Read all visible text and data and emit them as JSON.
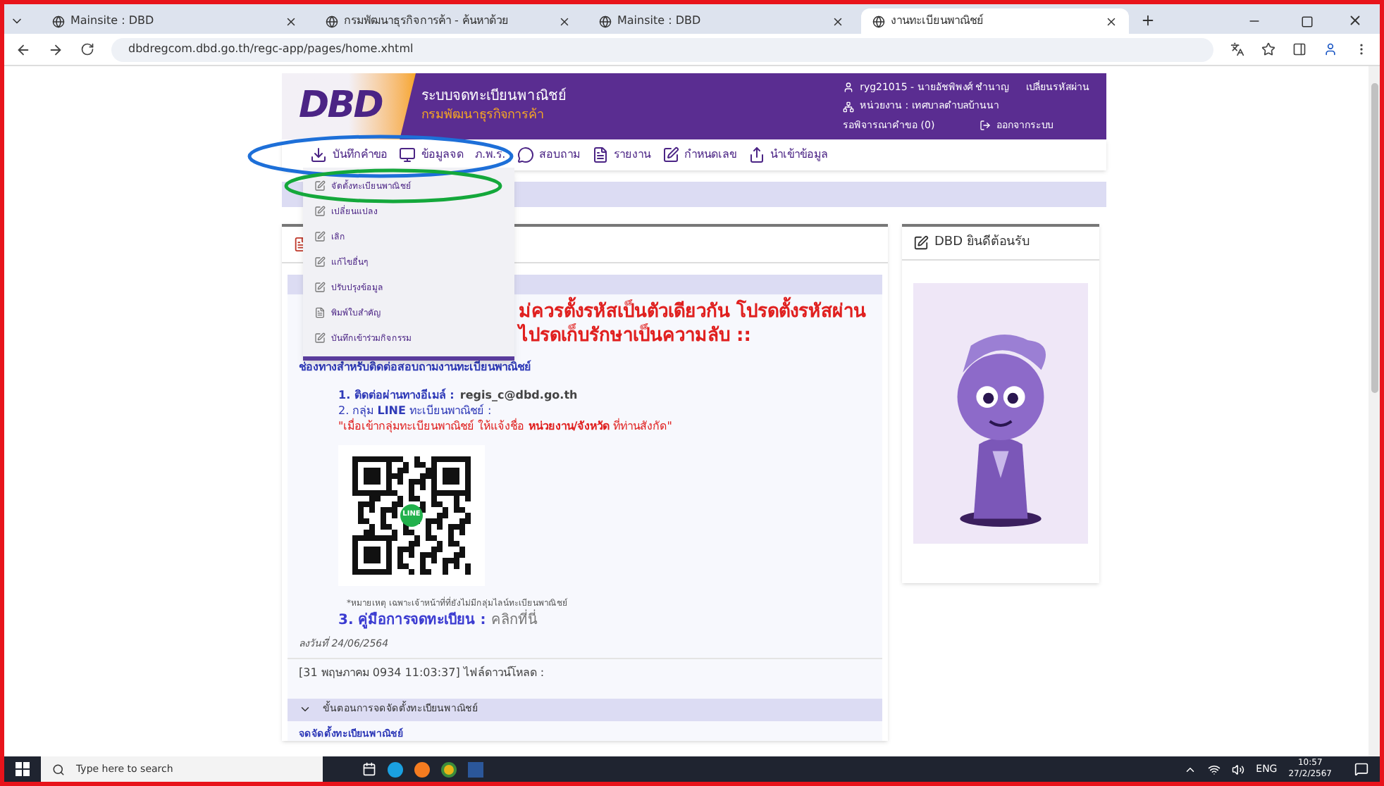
{
  "browser": {
    "tabs": [
      {
        "title": "Mainsite : DBD",
        "selected": false
      },
      {
        "title": "กรมพัฒนาธุรกิจการค้า - ค้นหาด้วย",
        "selected": false
      },
      {
        "title": "Mainsite : DBD",
        "selected": false
      },
      {
        "title": "งานทะเบียนพาณิชย์",
        "selected": true
      }
    ],
    "address": "dbdregcom.dbd.go.th/regc-app/pages/home.xhtml"
  },
  "header": {
    "logo": "DBD",
    "system_name": "ระบบจดทะเบียนพาณิชย์",
    "department": "กรมพัฒนาธุรกิจการค้า",
    "user": "ryg21015 - นายอัชพิพงศ์ ชำนาญ",
    "change_password": "เปลี่ยนรหัสผ่าน",
    "unit": "หน่วยงาน : เทศบาลตำบลบ้านนา",
    "pending": "รอพิจารณาคำขอ (0)",
    "logout": "ออกจากระบบ"
  },
  "nav": [
    {
      "label": "บันทึกคำขอ",
      "kind": "download"
    },
    {
      "label": "ข้อมูลจด",
      "kind": "monitor"
    },
    {
      "label": "ภ.พ.ร.",
      "kind": "none"
    },
    {
      "label": "สอบถาม",
      "kind": "chat"
    },
    {
      "label": "รายงาน",
      "kind": "doc"
    },
    {
      "label": "กำหนดเลข",
      "kind": "edit"
    },
    {
      "label": "นำเข้าข้อมูล",
      "kind": "share"
    }
  ],
  "dropdown": [
    {
      "label": "จัดตั้งทะเบียนพาณิชย์",
      "kind": "edit"
    },
    {
      "label": "เปลี่ยนแปลง",
      "kind": "edit"
    },
    {
      "label": "เลิก",
      "kind": "edit"
    },
    {
      "label": "แก้ไขอื่นๆ",
      "kind": "edit"
    },
    {
      "label": "ปรับปรุงข้อมูล",
      "kind": "edit"
    },
    {
      "label": "พิมพ์ใบสำคัญ",
      "kind": "doc"
    },
    {
      "label": "บันทึกเข้าร่วมกิจกรรม",
      "kind": "edit"
    }
  ],
  "notice": {
    "warning_lines": [
      "ม่ควรตั้งรหัสเป็นตัวเดียวกัน โปรดตั้งรหัสผ่าน",
      "ไปรดเก็บรักษาเป็นความลับ ::"
    ],
    "contact_title": "ช่องทางสำหรับติดต่อสอบถามงานทะเบียนพาณิชย์",
    "email_label": "1. ติดต่อผ่านทางอีเมล์ :",
    "email": "regis_c@dbd.go.th",
    "line_label": "2. กลุ่ม **LINE** ทะเบียนพาณิชย์ :",
    "line_note": "\"เมื่อเข้ากลุ่มทะเบียนพาณิชย์ ให้แจ้งชื่อ **หน่วยงาน/จังหวัด** ที่ท่านสังกัด\"",
    "qr_badge": "LINE",
    "remark": "*หมายเหตุ เฉพาะเจ้าหน้าที่ที่ยังไม่มีกลุ่มไลน์ทะเบียนพาณิชย์",
    "manual_label": "3. คู่มือการจดทะเบียน :",
    "manual_link": "คลิกที่นี่",
    "date": "ลงวันที่ 24/06/2564",
    "download": "[31 พฤษภาคม 0934 11:03:37] ไฟล์ดาวน์โหลด :"
  },
  "steps": {
    "title": "ขั้นตอนการจดจัดตั้งทะเบียนพาณิชย์",
    "expanded": true,
    "subtitle": "จดจัดตั้งทะเบียนพาณิชย์"
  },
  "welcome": {
    "title": "DBD ยินดีต้อนรับ"
  },
  "taskbar": {
    "search_placeholder": "Type here to search",
    "language": "ENG",
    "time": "10:57",
    "date": "27/2/2567"
  }
}
